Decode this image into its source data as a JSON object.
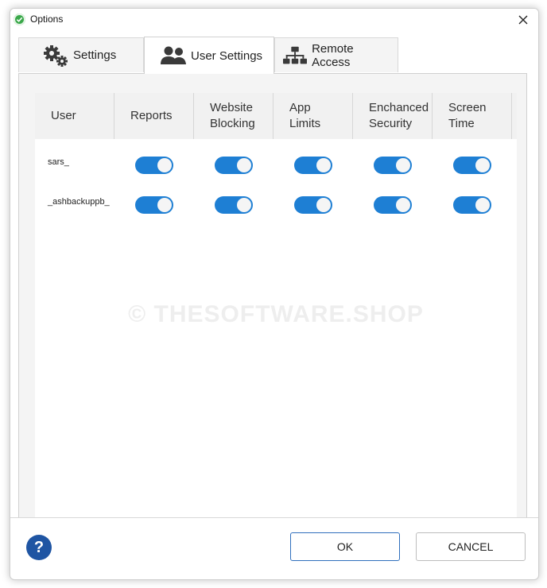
{
  "window": {
    "title": "Options"
  },
  "tabs": [
    {
      "label": "Settings",
      "icon": "gears-icon"
    },
    {
      "label": "User Settings",
      "icon": "users-icon"
    },
    {
      "label": "Remote Access",
      "icon": "network-icon"
    }
  ],
  "active_tab": "User Settings",
  "table": {
    "columns": [
      {
        "label": "User"
      },
      {
        "label": "Reports"
      },
      {
        "label": "Website\nBlocking"
      },
      {
        "label": "App\nLimits"
      },
      {
        "label": "Enchanced\nSecurity"
      },
      {
        "label": "Screen\nTime"
      }
    ],
    "rows": [
      {
        "user": "sars_",
        "reports": true,
        "website_blocking": true,
        "app_limits": true,
        "enhanced_security": true,
        "screen_time": true
      },
      {
        "user": "_ashbackuppb_",
        "reports": true,
        "website_blocking": true,
        "app_limits": true,
        "enhanced_security": true,
        "screen_time": true
      }
    ]
  },
  "watermark": "© THESOFTWARE.SHOP",
  "footer": {
    "help_label": "?",
    "ok_label": "OK",
    "cancel_label": "CANCEL"
  },
  "colors": {
    "toggle_on": "#1e7fd4",
    "help_button": "#1f55a3",
    "ok_border": "#2f6fbd"
  }
}
